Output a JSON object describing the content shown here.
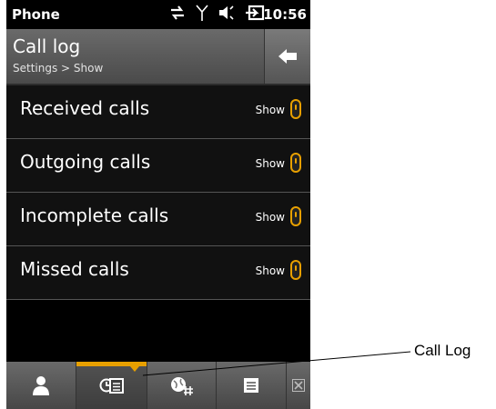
{
  "status_bar": {
    "app_name": "Phone",
    "time": "10:56",
    "icons": [
      "data-transfer-icon",
      "signal-icon",
      "speaker-icon",
      "battery-charging-icon"
    ]
  },
  "header": {
    "title": "Call log",
    "breadcrumb": "Settings > Show",
    "back_icon": "back-arrow-icon"
  },
  "settings": [
    {
      "label": "Received calls",
      "value": "Show"
    },
    {
      "label": "Outgoing calls",
      "value": "Show"
    },
    {
      "label": "Incomplete calls",
      "value": "Show"
    },
    {
      "label": "Missed calls",
      "value": "Show"
    }
  ],
  "tabbar": {
    "tabs": [
      {
        "name": "contacts",
        "icon": "person-icon"
      },
      {
        "name": "call-log",
        "icon": "call-log-icon",
        "active": true
      },
      {
        "name": "speed-dial",
        "icon": "globe-dial-icon"
      },
      {
        "name": "menu",
        "icon": "menu-icon"
      },
      {
        "name": "close",
        "icon": "close-icon"
      }
    ]
  },
  "annotation": {
    "label": "Call Log"
  },
  "colors": {
    "accent": "#e8a000",
    "background": "#000000",
    "header": "#5a5a5a"
  }
}
